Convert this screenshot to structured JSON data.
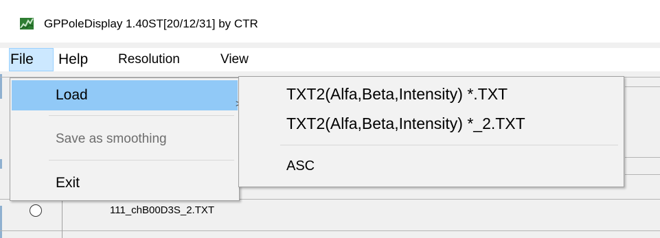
{
  "window": {
    "title": "GPPoleDisplay 1.40ST[20/12/31] by CTR",
    "icon": "app-graph-icon"
  },
  "menubar": {
    "items": [
      {
        "label": "File",
        "active": true
      },
      {
        "label": "Help"
      },
      {
        "label": "Resolution"
      },
      {
        "label": "View"
      }
    ]
  },
  "file_menu": {
    "items": [
      {
        "label": "Load",
        "submenu_arrow": ">",
        "highlighted": true
      },
      {
        "label": "Save as smoothing",
        "disabled": true
      },
      {
        "label": "Exit"
      }
    ]
  },
  "load_submenu": {
    "items": [
      {
        "label": "TXT2(Alfa,Beta,Intensity) *.TXT"
      },
      {
        "label": "TXT2(Alfa,Beta,Intensity) *_2.TXT"
      },
      {
        "label": "ASC"
      }
    ]
  },
  "file_list": {
    "rows": [
      {
        "filename": "111_chB00D3S_2.TXT",
        "selected": false
      }
    ]
  },
  "colors": {
    "menu_highlight": "#91c9f7",
    "menubar_active": "#cce8ff",
    "disabled_text": "#6d6d6d"
  }
}
